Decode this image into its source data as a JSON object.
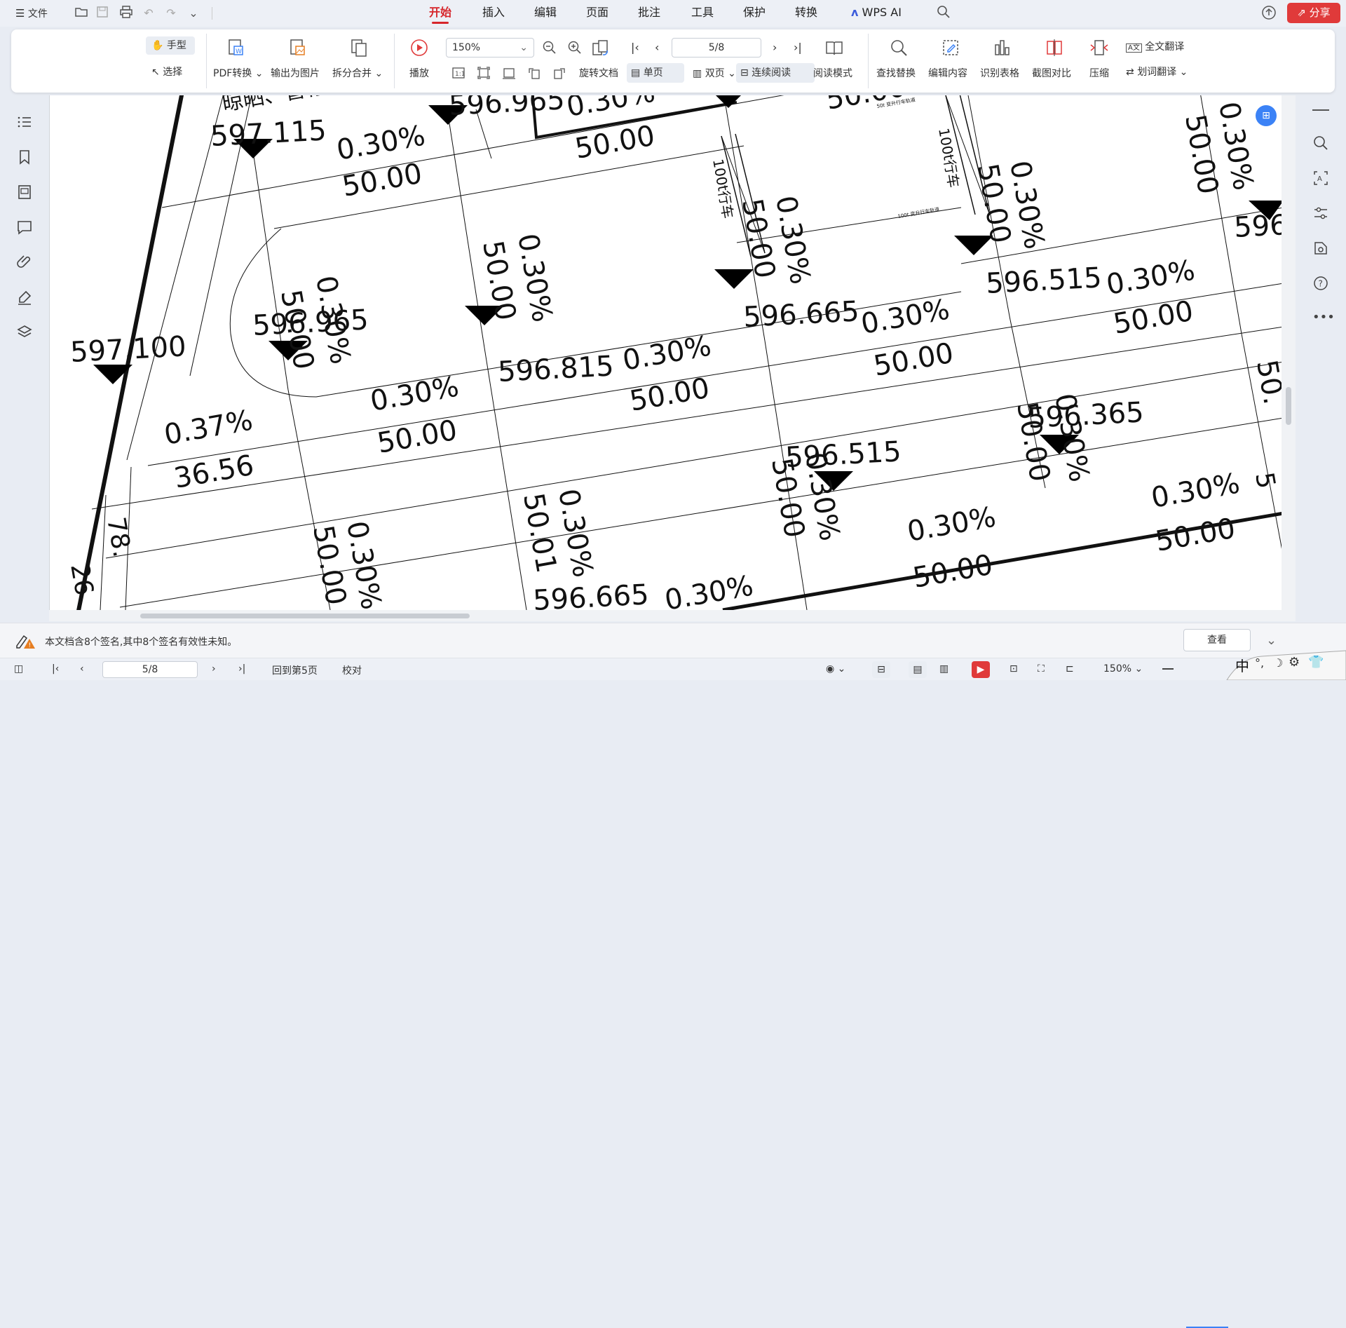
{
  "titlebar": {
    "file_menu": "文件",
    "tabs": [
      "开始",
      "插入",
      "编辑",
      "页面",
      "批注",
      "工具",
      "保护",
      "转换"
    ],
    "wps_ai": "WPS AI",
    "share": "分享",
    "accent": "#d6262b"
  },
  "ribbon": {
    "hand": "手型",
    "select": "选择",
    "pdf_convert": "PDF转换",
    "export_image": "输出为图片",
    "split_merge": "拆分合并",
    "play": "播放",
    "zoom": "150%",
    "rotate": "旋转文档",
    "single_page": "单页",
    "double_page": "双页",
    "continuous": "连续阅读",
    "reading_mode": "阅读模式",
    "page_indicator": "5/8",
    "find_replace": "查找替换",
    "edit_content": "编辑内容",
    "recognize_table": "识别表格",
    "screenshot_compare": "截图对比",
    "compress": "压缩",
    "full_translate": "全文翻译",
    "word_translate": "划词翻译"
  },
  "drawing": {
    "elevations": [
      {
        "label": "597.115"
      },
      {
        "label": "596.965"
      },
      {
        "label": "596.815"
      },
      {
        "label": "596.665"
      },
      {
        "label": "596.515"
      },
      {
        "label": "597.100"
      },
      {
        "label": "596.965"
      },
      {
        "label": "596.665"
      },
      {
        "label": "596.515"
      },
      {
        "label": "596.365"
      },
      {
        "label": "596.665"
      },
      {
        "label": "596."
      }
    ],
    "texts": {
      "slope": "0.30%",
      "slope2": "0.37%",
      "len": "50.00",
      "len2": "36.56",
      "len3": "50.01",
      "crane": "100t行车",
      "area": "晾晒、暂存区",
      "track": "50t 变升行车轨道",
      "track2": "100t 变升行车轨道",
      "frag1": "78.",
      "frag2": "26",
      "frag3": "5",
      "frag4": "50.",
      "frag5": "0"
    }
  },
  "notice": {
    "text": "本文档含8个签名,其中8个签名有效性未知。",
    "view": "查看"
  },
  "statusbar": {
    "page": "5/8",
    "goto": "回到第5页",
    "proofread": "校对",
    "zoom": "150%"
  },
  "ime": {
    "label": "中"
  }
}
